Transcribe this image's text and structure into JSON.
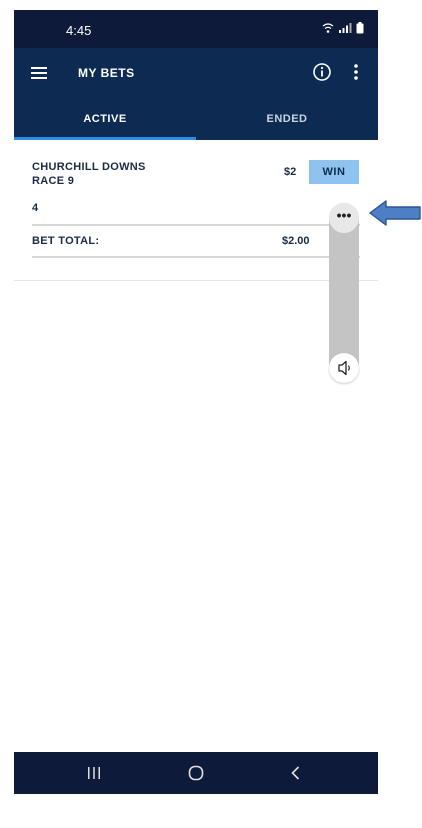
{
  "status_bar": {
    "time": "4:45",
    "icons": [
      "wifi-icon",
      "signal-icon",
      "battery-icon"
    ]
  },
  "app_bar": {
    "title": "MY BETS",
    "icons": [
      "menu-icon",
      "info-icon",
      "more-vert-icon"
    ]
  },
  "tabs": [
    {
      "label": "ACTIVE",
      "selected": true
    },
    {
      "label": "ENDED",
      "selected": false
    }
  ],
  "bet": {
    "track_line1": "CHURCHILL DOWNS",
    "track_line2": "RACE 9",
    "amount": "$2",
    "bet_type": "WIN",
    "selection": "4",
    "total_label": "BET TOTAL:",
    "total_value": "$2.00"
  },
  "volume_panel": {
    "more_label": "•••",
    "icons": [
      "more-horizontal-icon",
      "speaker-icon"
    ]
  },
  "nav_bar": {
    "icons": [
      "recent-apps-icon",
      "home-icon",
      "back-icon"
    ]
  },
  "colors": {
    "status_bar": "#0d1a3a",
    "app_bar": "#0d2b52",
    "tab_indicator": "#2d8ee3",
    "win_badge": "#8fc3ef",
    "annotation_arrow": "#4d7fc4"
  }
}
